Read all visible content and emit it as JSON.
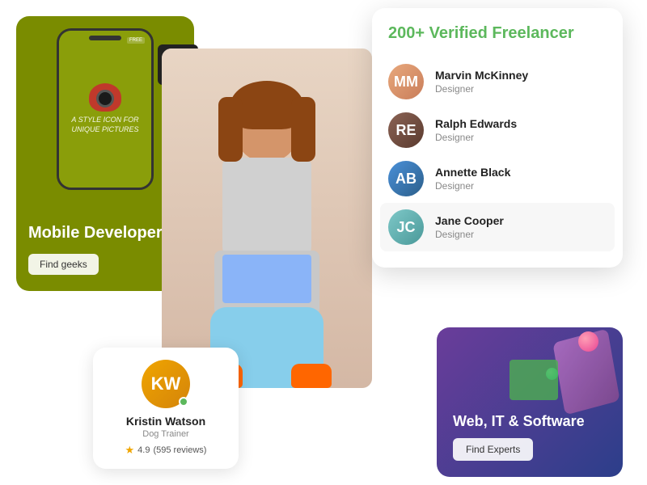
{
  "freelancer_card": {
    "title_prefix": "200+",
    "title_suffix": " Verified Freelancer",
    "freelancers": [
      {
        "id": "mm",
        "name": "Marvin McKinney",
        "role": "Designer",
        "initials": "MM",
        "avatar_class": "avatar-mm"
      },
      {
        "id": "re",
        "name": "Ralph Edwards",
        "role": "Designer",
        "initials": "RE",
        "avatar_class": "avatar-re"
      },
      {
        "id": "ab",
        "name": "Annette Black",
        "role": "Designer",
        "initials": "AB",
        "avatar_class": "avatar-ab"
      },
      {
        "id": "jc",
        "name": "Jane Cooper",
        "role": "Designer",
        "initials": "JC",
        "avatar_class": "avatar-jc",
        "active": true
      }
    ]
  },
  "mobile_card": {
    "title": "Mobile Developers",
    "button_label": "Find geeks"
  },
  "profile_card": {
    "name": "Kristin Watson",
    "role": "Dog Trainer",
    "rating": "4.9",
    "reviews": "(595 reviews)"
  },
  "web_card": {
    "title": "Web, IT & Software",
    "button_label": "Find Experts"
  }
}
